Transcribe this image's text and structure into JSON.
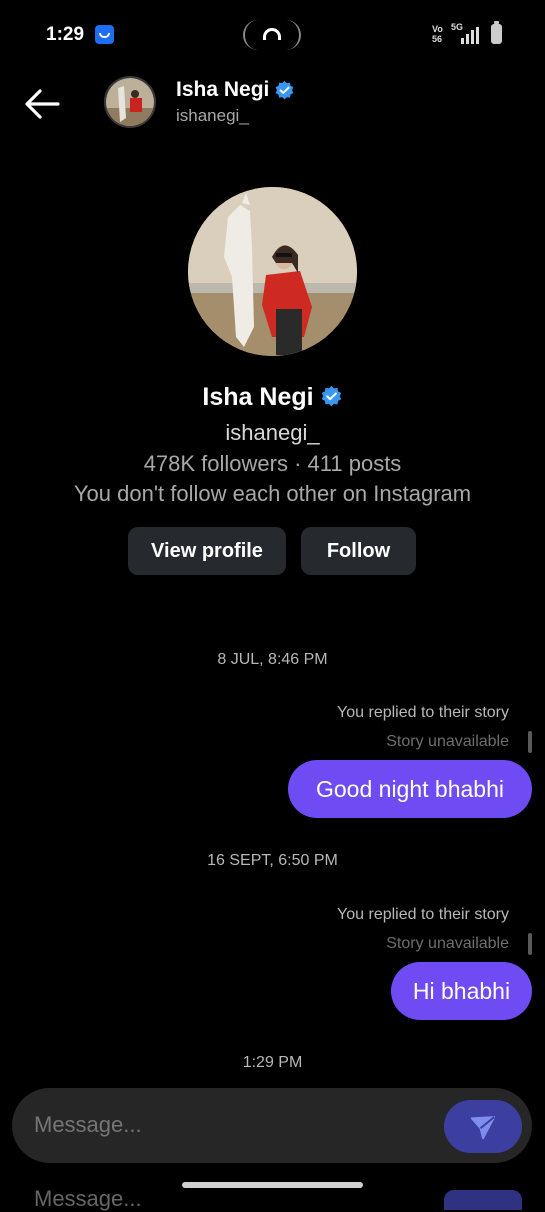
{
  "status_bar": {
    "time": "1:29",
    "volte": "Vo\n56",
    "network": "5G",
    "icons": [
      "vpn-icon",
      "hotspot-icon",
      "signal-icon",
      "battery-icon"
    ]
  },
  "header": {
    "name": "Isha Negi",
    "username": "ishanegi_",
    "verified": true,
    "icons": [
      "back-arrow-icon",
      "verified-badge-icon"
    ]
  },
  "profile": {
    "name": "Isha Negi",
    "username": "ishanegi_",
    "stats": "478K followers · 411 posts",
    "follow_status": "You don't follow each other on Instagram",
    "view_profile_label": "View profile",
    "follow_label": "Follow"
  },
  "messages": [
    {
      "timestamp": "8 JUL, 8:46 PM",
      "note": "You replied to their story",
      "story": "Story unavailable",
      "text": "Good night bhabhi"
    },
    {
      "timestamp": "16 SEPT, 6:50 PM",
      "note": "You replied to their story",
      "story": "Story unavailable",
      "text": "Hi bhabhi"
    }
  ],
  "last_timestamp": "1:29 PM",
  "composer": {
    "placeholder": "Message...",
    "send_icon": "send-icon",
    "ghost_text": "Message..."
  },
  "colors": {
    "background": "#000000",
    "bubble": "#6e4bf2",
    "button": "#262a2e",
    "verified": "#3897f0",
    "send_button": "#3c3fa0"
  }
}
